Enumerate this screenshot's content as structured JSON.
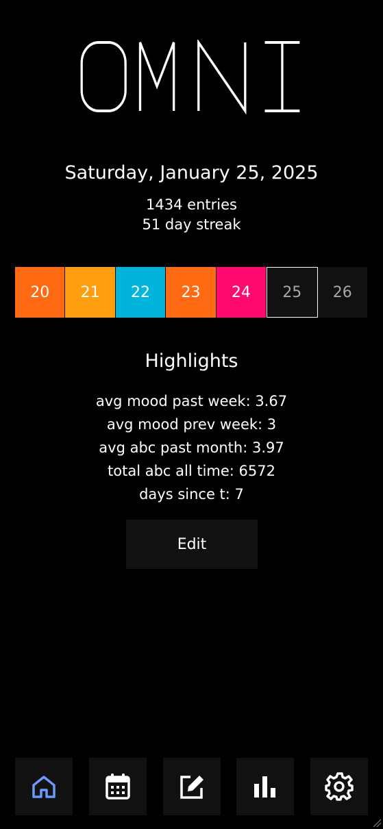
{
  "app": {
    "title": "OMNI"
  },
  "header": {
    "date": "Saturday, January 25, 2025",
    "entries": "1434 entries",
    "streak": "51 day streak"
  },
  "week_strip": [
    {
      "day": "20",
      "color": "#ff6a13",
      "state": "past"
    },
    {
      "day": "21",
      "color": "#ff9f10",
      "state": "past"
    },
    {
      "day": "22",
      "color": "#00b4dc",
      "state": "past"
    },
    {
      "day": "23",
      "color": "#ff6a13",
      "state": "past"
    },
    {
      "day": "24",
      "color": "#ff0a6f",
      "state": "past"
    },
    {
      "day": "25",
      "color": "#111111",
      "state": "today"
    },
    {
      "day": "26",
      "color": "#111111",
      "state": "future"
    }
  ],
  "highlights": {
    "title": "Highlights",
    "items": [
      "avg mood past week: 3.67",
      "avg mood prev week: 3",
      "avg abc past month: 3.97",
      "total abc all time: 6572",
      "days since t: 7"
    ],
    "edit_label": "Edit"
  },
  "nav": {
    "active": "home",
    "active_color": "#6b9bff",
    "items": [
      "home-icon",
      "calendar-icon",
      "edit-icon",
      "stats-icon",
      "settings-icon"
    ]
  }
}
